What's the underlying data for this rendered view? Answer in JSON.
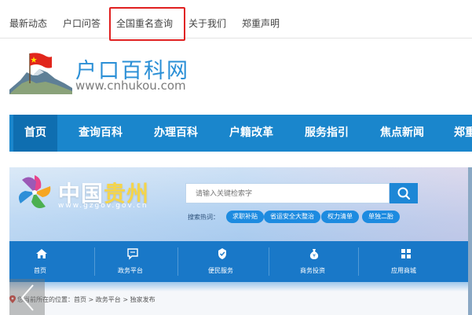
{
  "topnav": {
    "items": [
      "最新动态",
      "户口问答",
      "全国重名查询",
      "关于我们",
      "郑重声明"
    ]
  },
  "logo": {
    "title": "户口百科网",
    "url": "www.cnhukou.com"
  },
  "mainnav": {
    "items": [
      "首页",
      "查询百科",
      "办理百科",
      "户籍改革",
      "服务指引",
      "焦点新闻",
      "郑重"
    ]
  },
  "banner": {
    "logo_text_a": "中国",
    "logo_text_b": "贵州",
    "url": "www.gzgov.gov.cn",
    "search_placeholder": "请输入关键检索字",
    "hot_label": "搜索热词：",
    "hot_words": [
      "求职补贴",
      "省运安全大整治",
      "权力清单",
      "单独二胎"
    ],
    "nav": [
      "首页",
      "政务平台",
      "便民服务",
      "商务投资",
      "应用商城"
    ],
    "breadcrumb": "您当前所在的位置：首页 > 政务平台 > 独家发布"
  },
  "colors": {
    "nav_blue": "#1a86cc",
    "logo_blue": "#2a8fd6",
    "highlight_red": "#e02020"
  }
}
